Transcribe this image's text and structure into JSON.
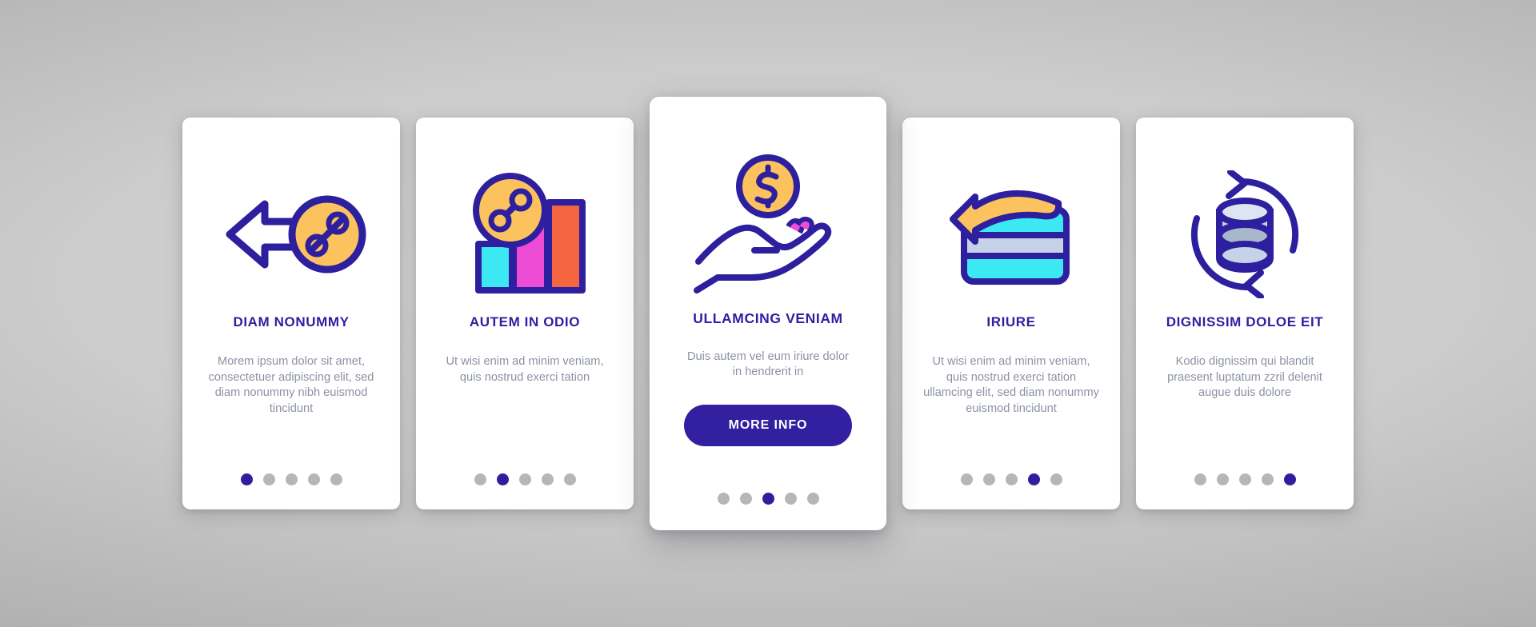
{
  "meta": {
    "background_color": "#cccccc",
    "card_background": "#ffffff",
    "accent_color": "#2d1f9e",
    "muted_text_color": "#8b92a0",
    "dot_inactive_color": "#b6b6b6",
    "yellow": "#fbc25e",
    "cyan": "#3ce8f2",
    "magenta": "#ef4cd6",
    "orange": "#f4663f",
    "light_blue": "#c6d2e8"
  },
  "cards": [
    {
      "id": "card-1",
      "featured": false,
      "icon_name": "arrow-left-percent-badge-icon",
      "title": "DIAM NONUMMY",
      "body": "Morem ipsum dolor sit amet, consectetuer adipiscing elit, sed diam nonummy nibh euismod tincidunt",
      "dots": {
        "count": 5,
        "active_index": 0
      }
    },
    {
      "id": "card-2",
      "featured": false,
      "icon_name": "bar-chart-percent-icon",
      "title": "AUTEM IN ODIO",
      "body": "Ut wisi enim ad minim veniam, quis nostrud exerci tation",
      "dots": {
        "count": 5,
        "active_index": 1
      }
    },
    {
      "id": "card-3",
      "featured": true,
      "icon_name": "hand-holding-dollar-coin-icon",
      "title": "ULLAMCING VENIAM",
      "body": "Duis autem vel eum iriure dolor in hendrerit in",
      "cta_label": "MORE INFO",
      "dots": {
        "count": 5,
        "active_index": 2
      }
    },
    {
      "id": "card-4",
      "featured": false,
      "icon_name": "credit-card-return-arrow-icon",
      "title": "IRIURE",
      "body": "Ut wisi enim ad minim veniam, quis nostrud exerci tation ullamcing elit, sed diam nonummy euismod tincidunt",
      "dots": {
        "count": 5,
        "active_index": 3
      }
    },
    {
      "id": "card-5",
      "featured": false,
      "icon_name": "database-refresh-icon",
      "title": "DIGNISSIM DOLOE EIT",
      "body": "Kodio dignissim qui blandit praesent luptatum zzril delenit augue duis dolore",
      "dots": {
        "count": 5,
        "active_index": 4
      }
    }
  ]
}
